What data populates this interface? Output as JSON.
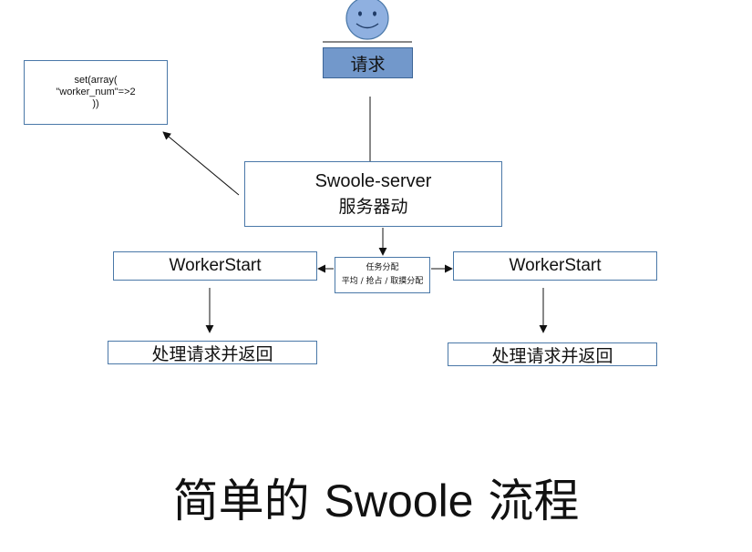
{
  "request_label": "请求",
  "config": {
    "line1": "set(array(",
    "line2": "\"worker_num\"=>2",
    "line3": "))"
  },
  "server": {
    "name": "Swoole-server",
    "subtitle": "服务器动"
  },
  "dispatch": {
    "line1": "任务分配",
    "line2": "平均 / 抢占 / 取摸分配"
  },
  "worker_left": "WorkerStart",
  "worker_right": "WorkerStart",
  "handle_left": "处理请求并返回",
  "handle_right": "处理请求并返回",
  "caption": {
    "prefix": "简单的",
    "name": "Swoole",
    "suffix": "流程"
  },
  "colors": {
    "request_fill": "#7298cb",
    "box_border": "#4a78a8",
    "face_fill": "#8fb0e0"
  },
  "icons": [
    "user-face-icon"
  ]
}
